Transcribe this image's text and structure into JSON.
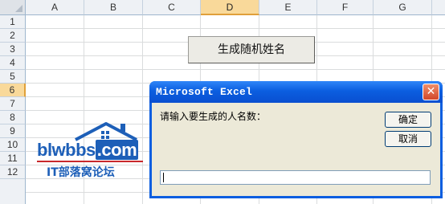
{
  "sheet": {
    "columns": [
      "A",
      "B",
      "C",
      "D",
      "E",
      "F",
      "G"
    ],
    "rows": [
      "1",
      "2",
      "3",
      "4",
      "5",
      "6",
      "7",
      "8",
      "9",
      "10",
      "11",
      "12"
    ],
    "selected_column": "D",
    "selected_row": "6",
    "button_label": "生成随机姓名"
  },
  "watermark": {
    "text": "blwbbs",
    "dotcom": ".com",
    "subtitle": "IT部落窝论坛"
  },
  "dialog": {
    "title": "Microsoft Excel",
    "close_glyph": "✕",
    "prompt": "请输入要生成的人名数：",
    "ok_label": "确定",
    "cancel_label": "取消",
    "input_value": ""
  },
  "colors": {
    "titlebar": "#0b5ee0",
    "header_selected": "#f9d99a",
    "logo_blue": "#1d5fb8",
    "logo_red": "#c8282c"
  }
}
